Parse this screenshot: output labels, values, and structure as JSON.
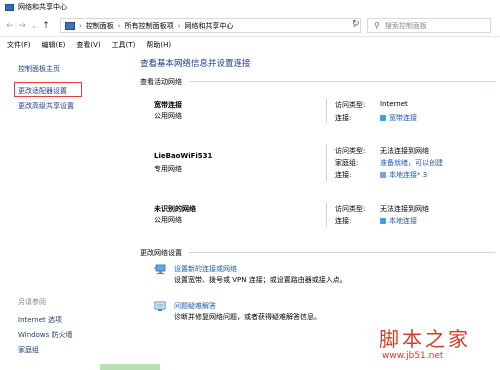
{
  "window": {
    "title": "网络和共享中心"
  },
  "nav": {
    "back": "←",
    "forward": "→",
    "dropdown": "⌄",
    "up": "↑"
  },
  "address": {
    "crumbs": [
      "控制面板",
      "所有控制面板项",
      "网络和共享中心"
    ],
    "separator": "›",
    "dropdown": "⌄",
    "refresh": "↻"
  },
  "search": {
    "placeholder": "搜索控制面板",
    "icon": "⚲"
  },
  "menu": [
    "文件(F)",
    "编辑(E)",
    "查看(V)",
    "工具(T)",
    "帮助(H)"
  ],
  "sidebar": {
    "links": [
      "控制面板主页",
      "更改适配器设置",
      "更改高级共享设置"
    ],
    "see_also_heading": "另请参阅",
    "see_also": [
      "Internet 选项",
      "Windows 防火墙",
      "家庭组"
    ]
  },
  "main": {
    "title": "查看基本网络信息并设置连接",
    "active_networks_label": "查看活动网络",
    "networks": [
      {
        "name": "宽带连接",
        "type": "公用网络",
        "rows": [
          {
            "key": "访问类型:",
            "value": "Internet",
            "link": false
          },
          {
            "key": "连接:",
            "value": "宽带连接",
            "link": true
          }
        ]
      },
      {
        "name": "LieBaoWiFi531",
        "type": "专用网络",
        "rows": [
          {
            "key": "访问类型:",
            "value": "无法连接到网络",
            "link": false
          },
          {
            "key": "家庭组:",
            "value": "准备就绪，可以创建",
            "link": true
          },
          {
            "key": "连接:",
            "value": "本地连接* 3",
            "link": true
          }
        ]
      },
      {
        "name": "未识别的网络",
        "type": "公用网络",
        "rows": [
          {
            "key": "访问类型:",
            "value": "无法连接到网络",
            "link": false
          },
          {
            "key": "连接:",
            "value": "本地连接",
            "link": true
          }
        ]
      }
    ],
    "change_settings_label": "更改网络设置",
    "tasks": [
      {
        "link": "设置新的连接或网络",
        "desc": "设置宽带、拨号或 VPN 连接；或设置路由器或接入点。"
      },
      {
        "link": "问题疑难解答",
        "desc": "诊断并修复网络问题，或者获得疑难解答信息。"
      }
    ]
  },
  "watermark": {
    "text": "脚本之家",
    "url": "www.jb51.net"
  }
}
